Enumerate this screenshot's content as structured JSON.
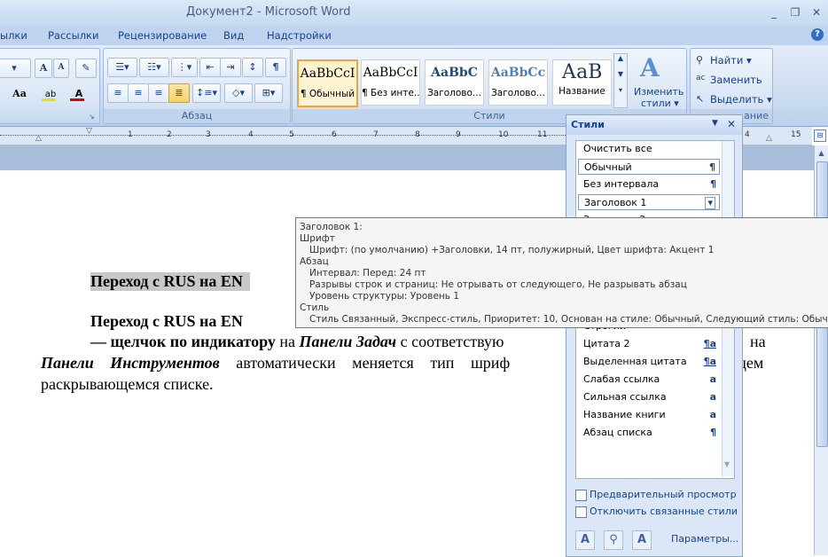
{
  "window": {
    "title": "Документ2 - Microsoft Word",
    "minimize": "_",
    "restore": "❐",
    "close": "✕"
  },
  "tabs": [
    "ылки",
    "Рассылки",
    "Рецензирование",
    "Вид",
    "Надстройки"
  ],
  "help_icon": "?",
  "ribbon": {
    "font_group": {
      "grow": "A",
      "shrink": "A",
      "case": "Aa"
    },
    "paragraph_group": {
      "label": "Абзац"
    },
    "styles_group": {
      "label": "Стили",
      "gallery": [
        {
          "sample": "AaBbCcI",
          "name": "¶ Обычный"
        },
        {
          "sample": "AaBbCcI",
          "name": "¶ Без инте..."
        },
        {
          "sample": "AaBbC",
          "name": "Заголово..."
        },
        {
          "sample": "AaBbCc",
          "name": "Заголово..."
        },
        {
          "sample": "АаВ",
          "name": "Название"
        }
      ],
      "change_styles_line1": "Изменить",
      "change_styles_line2": "стили ▾"
    },
    "editing_group": {
      "find": "Найти ▾",
      "replace": "Заменить",
      "select": "Выделить ▾",
      "label": "ание"
    }
  },
  "ruler": {
    "numbers": [
      "1",
      "2",
      "3",
      "4",
      "5",
      "6",
      "7",
      "8",
      "9",
      "10",
      "11",
      "4",
      "15"
    ]
  },
  "document": {
    "heading1": "Переход с RUS на EN",
    "heading2": "Переход с RUS на EN",
    "line3_bold": "— щелчок по индикатору",
    "line3_mid": " на ",
    "line3_italic": "Панели Задач",
    "line3_rest": " с соответствую",
    "line3_end": "на",
    "line4_italic": "Панели Инструментов",
    "line4_rest": " автоматически меняется тип шриф",
    "line4_end": "щем",
    "line5": "раскрывающемся списке."
  },
  "styles_pane": {
    "title": "Стили",
    "items": [
      {
        "label": "Очистить все",
        "mark": ""
      },
      {
        "label": "Обычный",
        "mark": "¶"
      },
      {
        "label": "Без интервала",
        "mark": "¶"
      },
      {
        "label": "Заголовок 1",
        "mark": "▾"
      },
      {
        "label": "Заголовок 2",
        "mark": ""
      },
      {
        "label": "Строгий",
        "mark": ""
      },
      {
        "label": "Цитата 2",
        "mark": "¶a"
      },
      {
        "label": "Выделенная цитата",
        "mark": "¶a"
      },
      {
        "label": "Слабая ссылка",
        "mark": "a"
      },
      {
        "label": "Сильная ссылка",
        "mark": "a"
      },
      {
        "label": "Название книги",
        "mark": "a"
      },
      {
        "label": "Абзац списка",
        "mark": "¶"
      }
    ],
    "preview_label": "Предварительный просмотр",
    "disable_linked_label": "Отключить связанные стили",
    "options_link": "Параметры..."
  },
  "tooltip": {
    "lines": [
      "Заголовок 1:",
      "Шрифт",
      "Шрифт:  (по умолчанию) +Заголовки, 14 пт, полужирный, Цвет шрифта: Акцент 1",
      "Абзац",
      "Интервал:  Перед:  24 пт",
      "Разрывы строк и страниц:  Не отрывать от следующего, Не разрывать абзац",
      "Уровень структуры:  Уровень 1",
      "Стиль",
      "Стиль Связанный, Экспресс-стиль, Приоритет: 10, Основан на стиле: Обычный, Следующий стиль: Обычный"
    ]
  }
}
